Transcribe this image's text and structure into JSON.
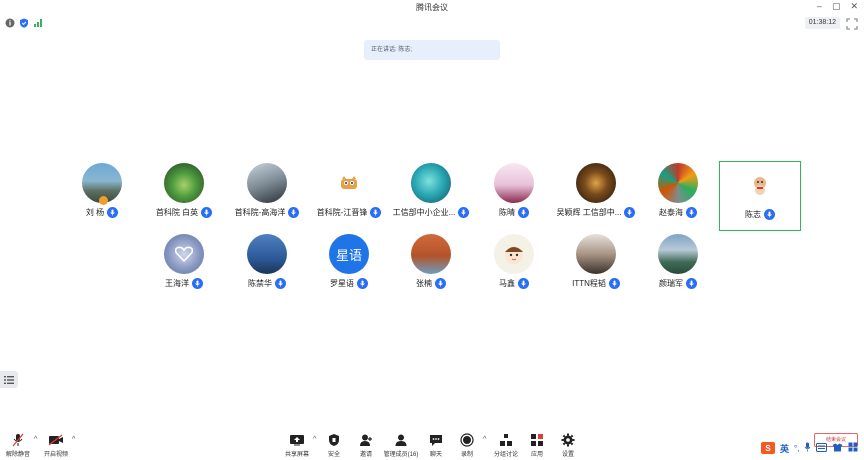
{
  "window": {
    "title": "腾讯会议",
    "timer": "01:38:12"
  },
  "speaking": {
    "prefix": "正在讲话:",
    "name": "陈志;"
  },
  "participants": [
    {
      "name": "刘 杨"
    },
    {
      "name": "首科院 白英"
    },
    {
      "name": "首科院-高海洋"
    },
    {
      "name": "首科院-江晋锋"
    },
    {
      "name": "工信部中小企业..."
    },
    {
      "name": "陈晴"
    },
    {
      "name": "吴颖辉 工信部中..."
    },
    {
      "name": "赵泰海"
    },
    {
      "name": "陈志"
    },
    {
      "name": "王海洋"
    },
    {
      "name": "陈禁华"
    },
    {
      "name": "罗星语",
      "avatar_text": "星语"
    },
    {
      "name": "张楠"
    },
    {
      "name": "马鑫"
    },
    {
      "name": "ITTN程韬"
    },
    {
      "name": "颜瑞军"
    }
  ],
  "toolbar": {
    "mute": "解除静音",
    "video": "开启视频",
    "share": "共享屏幕",
    "security": "安全",
    "invite": "邀请",
    "members": "管理成员(16)",
    "chat": "聊天",
    "record": "录制",
    "breakout": "分组讨论",
    "apps": "应用",
    "settings": "设置"
  },
  "tray": {
    "ime_lang": "英",
    "end_button": "结束会议"
  },
  "colors": {
    "accent": "#2a6ef5",
    "active_border": "#2fb55b",
    "speaking_bg": "#e6effb"
  }
}
